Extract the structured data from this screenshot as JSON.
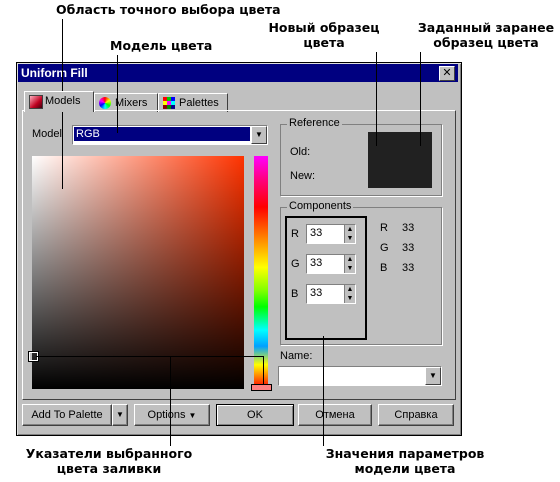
{
  "annotations": {
    "precise_area": "Область точного выбора цвета",
    "color_model": "Модель цвета",
    "new_sample": "Новый образец\nцвета",
    "preset_sample": "Заданный заранее\nобразец цвета",
    "pointers": "Указатели выбранного\nцвета заливки",
    "param_values": "Значения параметров\nмодели цвета"
  },
  "window": {
    "title": "Uniform Fill",
    "close_glyph": "✕"
  },
  "tabs": [
    {
      "label": "Models",
      "icon": "models-icon"
    },
    {
      "label": "Mixers",
      "icon": "color-wheel-icon"
    },
    {
      "label": "Palettes",
      "icon": "palette-grid-icon"
    }
  ],
  "model": {
    "label": "Model",
    "value": "RGB"
  },
  "reference": {
    "caption": "Reference",
    "old_label": "Old:",
    "new_label": "New:",
    "new_color": "#212121",
    "old_color": "#212121"
  },
  "components": {
    "caption": "Components",
    "fields": [
      {
        "label": "R",
        "value": "33"
      },
      {
        "label": "G",
        "value": "33"
      },
      {
        "label": "B",
        "value": "33"
      }
    ],
    "readout": [
      {
        "label": "R",
        "value": "33"
      },
      {
        "label": "G",
        "value": "33"
      },
      {
        "label": "B",
        "value": "33"
      }
    ]
  },
  "name": {
    "label": "Name:",
    "value": ""
  },
  "buttons": {
    "add_to_palette": "Add To Palette",
    "options": "Options",
    "ok": "OK",
    "cancel": "Отмена",
    "help": "Справка"
  },
  "colors": {
    "hue_selected": "#ff3300",
    "accent": "#000080"
  }
}
